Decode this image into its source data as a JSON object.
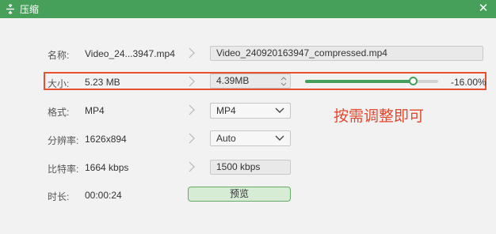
{
  "window": {
    "title": "压缩",
    "icon": "compress-icon",
    "close_icon": "close-icon"
  },
  "rows": {
    "name": {
      "label": "名称:",
      "original": "Video_24...3947.mp4",
      "output": "Video_240920163947_compressed.mp4"
    },
    "size": {
      "label": "大小:",
      "original": "5.23 MB",
      "output": "4.39MB",
      "percent": "-16.00%",
      "slider_level": 0.81
    },
    "format": {
      "label": "格式:",
      "original": "MP4",
      "output": "MP4"
    },
    "resolution": {
      "label": "分辨率:",
      "original": "1626x894",
      "output": "Auto"
    },
    "bitrate": {
      "label": "比特率:",
      "original": "1664 kbps",
      "output": "1500 kbps"
    },
    "duration": {
      "label": "时长:",
      "original": "00:00:24",
      "preview_label": "预览"
    }
  },
  "annotation": "按需调整即可",
  "colors": {
    "titlebar": "#46a05a",
    "accent": "#46a05a",
    "highlight": "#e5502f",
    "annotation": "#e5472c"
  }
}
